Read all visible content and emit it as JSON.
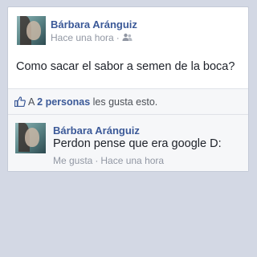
{
  "post": {
    "author": "Bárbara Aránguiz",
    "time": "Hace una hora",
    "separator": "·",
    "audience_icon": "friends-icon",
    "text": "Como sacar el sabor a semen de la boca?"
  },
  "likes": {
    "icon": "thumbs-up-icon",
    "prefix": "A",
    "count": "2 personas",
    "suffix": "les gusta esto."
  },
  "comment": {
    "author": "Bárbara Aránguiz",
    "text": "Perdon pense que era google D:",
    "like_label": "Me gusta",
    "separator": "·",
    "time": "Hace una hora"
  },
  "colors": {
    "background": "#d3d8e4",
    "link": "#3b5998",
    "meta": "#9197a3"
  }
}
